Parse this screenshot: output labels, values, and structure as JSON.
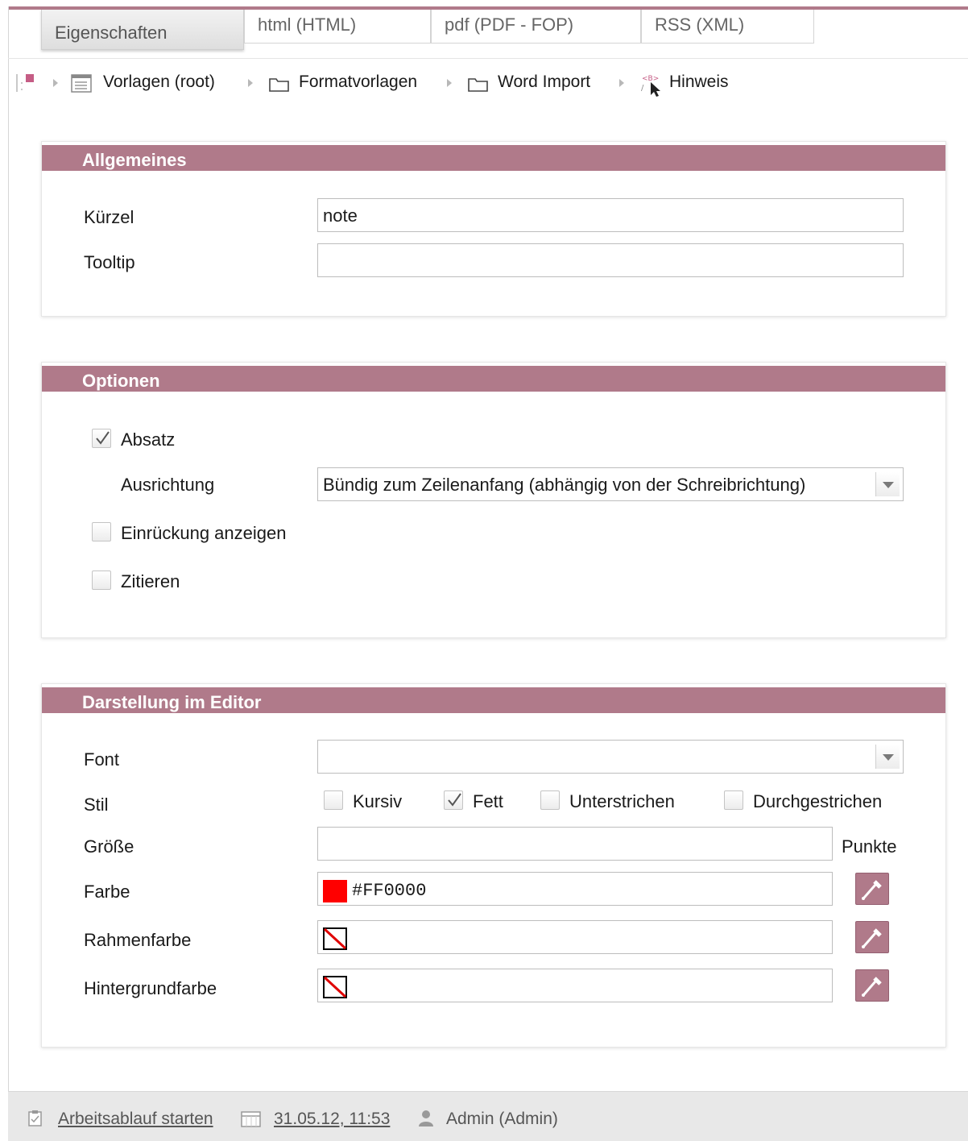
{
  "tabs": [
    {
      "label": "Eigenschaften",
      "active": true
    },
    {
      "label": "html (HTML)",
      "active": false
    },
    {
      "label": "pdf (PDF - FOP)",
      "active": false
    },
    {
      "label": "RSS (XML)",
      "active": false
    }
  ],
  "breadcrumb": {
    "items": [
      {
        "label": "Vorlagen (root)",
        "icon": "template-list-icon"
      },
      {
        "label": "Formatvorlagen",
        "icon": "folder-icon"
      },
      {
        "label": "Word Import",
        "icon": "folder-icon"
      },
      {
        "label": "Hinweis",
        "icon": "format-template-icon"
      }
    ]
  },
  "allgemeines": {
    "title": "Allgemeines",
    "kuerzel_label": "Kürzel",
    "kuerzel_value": "note",
    "tooltip_label": "Tooltip",
    "tooltip_value": ""
  },
  "optionen": {
    "title": "Optionen",
    "absatz_label": "Absatz",
    "absatz_checked": true,
    "ausrichtung_label": "Ausrichtung",
    "ausrichtung_value": "Bündig zum Zeilenanfang (abhängig von der Schreibrichtung)",
    "einrueckung_label": "Einrückung anzeigen",
    "einrueckung_checked": false,
    "zitieren_label": "Zitieren",
    "zitieren_checked": false
  },
  "darstellung": {
    "title": "Darstellung im Editor",
    "font_label": "Font",
    "font_value": "",
    "stil_label": "Stil",
    "stil_options": [
      {
        "label": "Kursiv",
        "checked": false
      },
      {
        "label": "Fett",
        "checked": true
      },
      {
        "label": "Unterstrichen",
        "checked": false
      },
      {
        "label": "Durchgestrichen",
        "checked": false
      }
    ],
    "groesse_label": "Größe",
    "groesse_value": "",
    "groesse_unit": "Punkte",
    "farbe_label": "Farbe",
    "farbe_value": "#FF0000",
    "farbe_color": "#FF0000",
    "rahmenfarbe_label": "Rahmenfarbe",
    "hintergrundfarbe_label": "Hintergrundfarbe"
  },
  "footer": {
    "workflow_label": "Arbeitsablauf starten",
    "date_label": "31.05.12, 11:53",
    "user_label": "Admin (Admin)"
  },
  "colors": {
    "accent": "#B07A8A",
    "footer_bg": "#E8E8E8"
  }
}
